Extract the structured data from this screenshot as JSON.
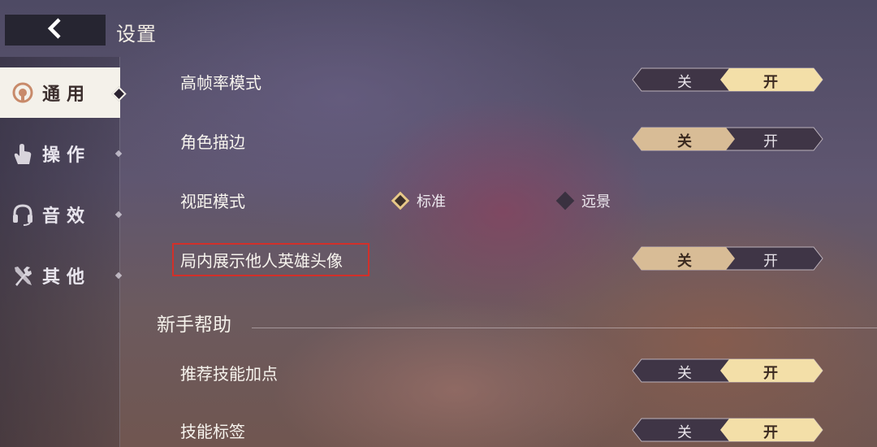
{
  "header": {
    "title": "设置",
    "back_icon": "chevron-left-icon"
  },
  "sidebar": {
    "items": [
      {
        "label": "通用",
        "icon": "general-icon",
        "active": true
      },
      {
        "label": "操作",
        "icon": "hand-icon",
        "active": false
      },
      {
        "label": "音效",
        "icon": "headset-icon",
        "active": false
      },
      {
        "label": "其他",
        "icon": "tools-icon",
        "active": false
      }
    ]
  },
  "settings": {
    "high_fps": {
      "label": "高帧率模式",
      "off": "关",
      "on": "开",
      "value": "开"
    },
    "outline": {
      "label": "角色描边",
      "off": "关",
      "on": "开",
      "value": "关"
    },
    "view_distance": {
      "label": "视距模式",
      "options": [
        "标准",
        "远景"
      ],
      "value": "标准"
    },
    "show_avatars": {
      "label": "局内展示他人英雄头像",
      "off": "关",
      "on": "开",
      "value": "关"
    }
  },
  "newbie_help": {
    "title": "新手帮助",
    "skill_points": {
      "label": "推荐技能加点",
      "off": "关",
      "on": "开",
      "value": "开"
    },
    "skill_tags": {
      "label": "技能标签",
      "off": "关",
      "on": "开",
      "value": "开"
    }
  },
  "colors": {
    "accent": "#f3dfa8",
    "active_off": "#d8bc96",
    "toggle_bg": "#3f3546",
    "highlight": "#d2302a"
  }
}
